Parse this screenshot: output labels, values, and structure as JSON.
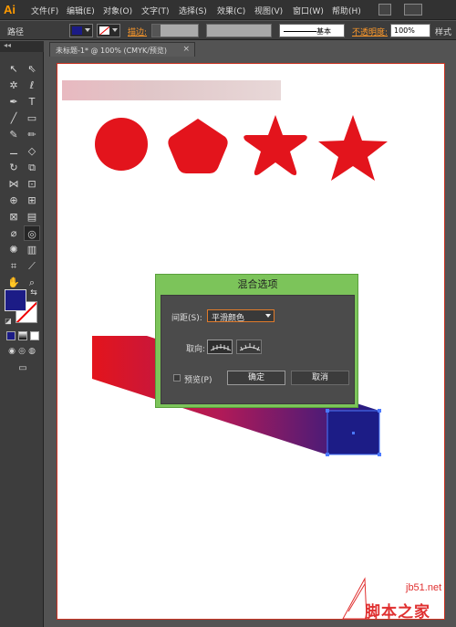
{
  "app": {
    "logo": "Ai"
  },
  "menu": [
    "文件(F)",
    "编辑(E)",
    "对象(O)",
    "文字(T)",
    "选择(S)",
    "效果(C)",
    "视图(V)",
    "窗口(W)",
    "帮助(H)"
  ],
  "control_bar": {
    "path_label": "路径",
    "stroke_label": "描边:",
    "brush_label": "基本",
    "opacity_label": "不透明度:",
    "opacity_value": "100%",
    "style_label": "样式"
  },
  "tools_header": "◂◂",
  "document": {
    "tab_title": "未标题-1* @ 100% (CMYK/预览)",
    "tab_close": "×"
  },
  "colors": {
    "fill": "#1c1c86",
    "shape_red": "#e3141c",
    "accent_orange": "#ff9a2a",
    "dialog_border": "#7cc45a"
  },
  "dialog": {
    "title": "混合选项",
    "spacing_label": "间距(S):",
    "spacing_value": "平滑颜色",
    "orientation_label": "取向:",
    "preview_label": "预览(P)",
    "ok_label": "确定",
    "cancel_label": "取消"
  },
  "watermark": {
    "site": "jb51.net",
    "name": "脚本之家"
  }
}
